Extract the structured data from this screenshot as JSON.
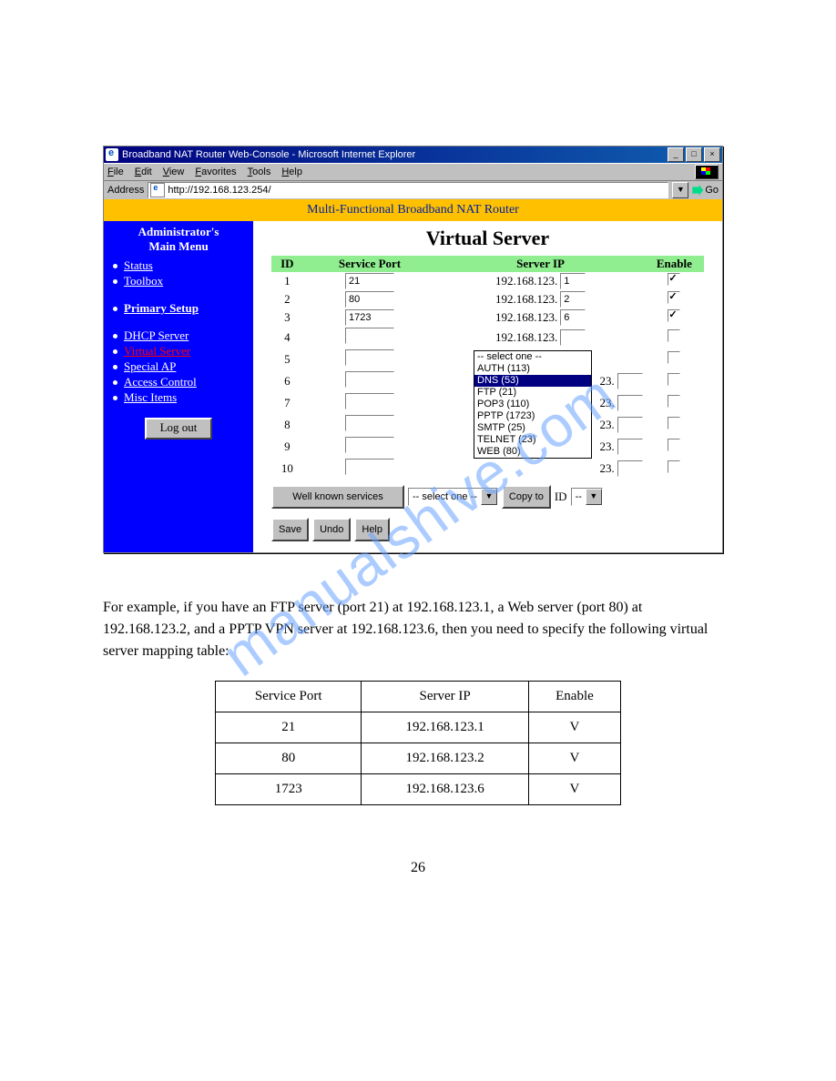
{
  "browser": {
    "title": "Broadband NAT Router Web-Console - Microsoft Internet Explorer",
    "menus": {
      "file": "File",
      "edit": "Edit",
      "view": "View",
      "favorites": "Favorites",
      "tools": "Tools",
      "help": "Help"
    },
    "address_label": "Address",
    "url": "http://192.168.123.254/",
    "go_label": "Go"
  },
  "banner": "Multi-Functional Broadband NAT Router",
  "sidebar": {
    "title1": "Administrator's",
    "title2": "Main Menu",
    "items": [
      {
        "label": "Status",
        "style": "std"
      },
      {
        "label": "Toolbox",
        "style": "std"
      },
      {
        "label": "Primary Setup",
        "style": "bold"
      },
      {
        "label": "DHCP Server",
        "style": "std"
      },
      {
        "label": "Virtual Server",
        "style": "visited"
      },
      {
        "label": "Special AP",
        "style": "std"
      },
      {
        "label": "Access Control",
        "style": "std"
      },
      {
        "label": "Misc Items",
        "style": "std"
      }
    ],
    "logout": "Log out"
  },
  "main": {
    "title": "Virtual Server",
    "headers": {
      "id": "ID",
      "port": "Service Port",
      "ip": "Server IP",
      "enable": "Enable"
    },
    "ip_prefix": "192.168.123.",
    "rows": [
      {
        "id": "1",
        "port": "21",
        "ip": "1",
        "enabled": true
      },
      {
        "id": "2",
        "port": "80",
        "ip": "2",
        "enabled": true
      },
      {
        "id": "3",
        "port": "1723",
        "ip": "6",
        "enabled": true
      },
      {
        "id": "4",
        "port": "",
        "ip": "",
        "enabled": false
      },
      {
        "id": "5",
        "port": "",
        "ip": "",
        "enabled": false
      }
    ],
    "short_rows": [
      {
        "id": "6",
        "ip_suffix": "23.",
        "oct": ""
      },
      {
        "id": "7",
        "ip_suffix": "23.",
        "oct": ""
      },
      {
        "id": "8",
        "ip_suffix": "23.",
        "oct": ""
      },
      {
        "id": "9",
        "ip_suffix": "23.",
        "oct": ""
      },
      {
        "id": "10",
        "ip_suffix": "23.",
        "oct": ""
      }
    ],
    "dropdown_options": [
      "-- select one --",
      "AUTH (113)",
      "DNS (53)",
      "FTP (21)",
      "POP3 (110)",
      "PPTP (1723)",
      "SMTP (25)",
      "TELNET (23)",
      "WEB (80)"
    ],
    "dropdown_selected_index": 2,
    "wellknown_label": "Well known services",
    "wellknown_current": "-- select one --",
    "copy_label": "Copy to",
    "id_label": "ID",
    "id_select_value": "--",
    "buttons": {
      "save": "Save",
      "undo": "Undo",
      "help": "Help"
    }
  },
  "watermark": "manualshive.com",
  "body": {
    "p1": "For example, if you have an FTP server (port 21) at 192.168.123.1, a Web server (port 80) at 192.168.123.2, and a PPTP VPN server at 192.168.123.6, then you need to specify the following virtual server mapping table:"
  },
  "svctable": {
    "headers": {
      "port": "Service Port",
      "ip": "Server IP",
      "enable": "Enable"
    },
    "rows": [
      {
        "port": "21",
        "ip": "192.168.123.1",
        "enable": "V"
      },
      {
        "port": "80",
        "ip": "192.168.123.2",
        "enable": "V"
      },
      {
        "port": "1723",
        "ip": "192.168.123.6",
        "enable": "V"
      }
    ]
  },
  "pagenum": "26"
}
